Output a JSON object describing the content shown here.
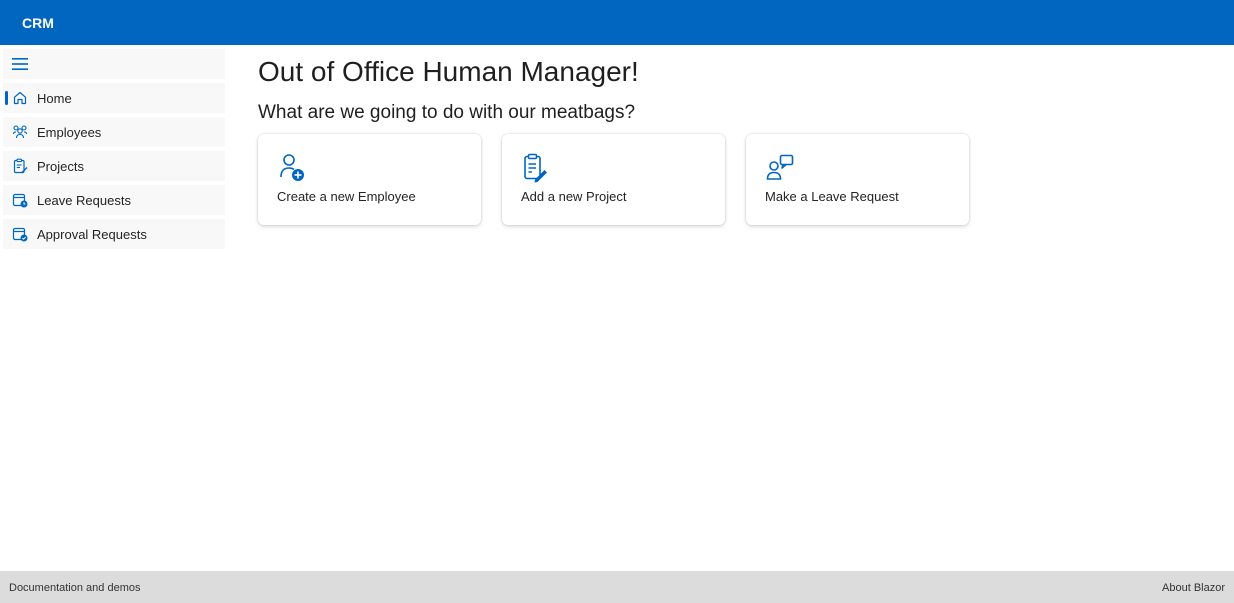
{
  "header": {
    "brand": "CRM"
  },
  "sidebar": {
    "items": [
      {
        "label": "Home",
        "icon": "home-icon",
        "active": true
      },
      {
        "label": "Employees",
        "icon": "people-team-icon"
      },
      {
        "label": "Projects",
        "icon": "clipboard-edit-icon"
      },
      {
        "label": "Leave Requests",
        "icon": "calendar-clock-icon"
      },
      {
        "label": "Approval Requests",
        "icon": "calendar-checkmark-icon"
      }
    ]
  },
  "main": {
    "title": "Out of Office Human Manager!",
    "subtitle": "What are we going to do with our meatbags?",
    "cards": [
      {
        "label": "Create a new Employee",
        "icon": "person-add-icon"
      },
      {
        "label": "Add a new Project",
        "icon": "clipboard-edit-icon"
      },
      {
        "label": "Make a Leave Request",
        "icon": "person-chat-icon"
      }
    ]
  },
  "footer": {
    "left_link": "Documentation and demos",
    "right_link": "About Blazor"
  },
  "colors": {
    "accent": "#0066c0",
    "footer_bg": "#dcdcdc",
    "nav_bg": "#f8f8f8"
  }
}
